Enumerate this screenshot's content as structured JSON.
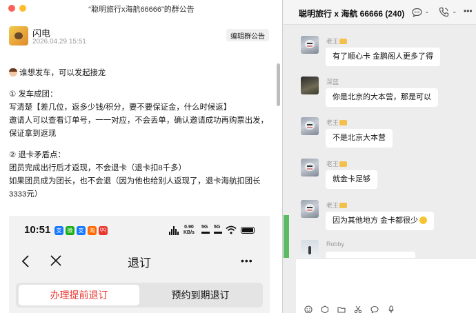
{
  "announcement": {
    "window_title": "“聪明旅行x海航66666”的群公告",
    "author": "闪电",
    "date": "2026.04.29 15:51",
    "edit_label": "编辑群公告",
    "lines": [
      "谁想发车，可以发起接龙",
      "① 发车成团：",
      "写清楚【差几位，返多少钱/积分，要不要保证金，什么时候返】",
      "邀请人可以查看订单号，一一对应，不会丢单，确认邀请成功再购票出发，保证拿到返现",
      "② 退卡矛盾点：",
      "团员完成出行后才返现，不会退卡（退卡扣8千多）",
      "如果团员成为团长，也不会退（因为他也给别人返现了，退卡海航扣团长3333元）"
    ],
    "screenshot": {
      "time": "10:51",
      "app_icons": [
        "支",
        "微",
        "支",
        "淘",
        "QQ"
      ],
      "net_speed_top": "0.90",
      "net_speed_bottom": "KB/s",
      "sim1": "5G",
      "sim2": "5G",
      "nav_title": "退订",
      "tab_active": "办理提前退订",
      "tab_inactive": "预约到期退订"
    }
  },
  "chat": {
    "title": "聪明旅行 x 海航 66666 (240)",
    "messages": [
      {
        "sender": "老王",
        "text": "有了顺心卡 金鹏阁人更多了得"
      },
      {
        "sender": "深蓝",
        "text": "你是北京的大本营，那是可以"
      },
      {
        "sender": "老王",
        "text": "不是北京大本营"
      },
      {
        "sender": "老王",
        "text": "就金卡足够"
      },
      {
        "sender": "老王",
        "text": "因为其他地方 金卡都很少"
      },
      {
        "sender": "Robby",
        "text": ""
      }
    ]
  },
  "colors": {
    "accent_red": "#e8372f",
    "wechat_green": "#5dbb63",
    "bubble_white": "#ffffff"
  }
}
